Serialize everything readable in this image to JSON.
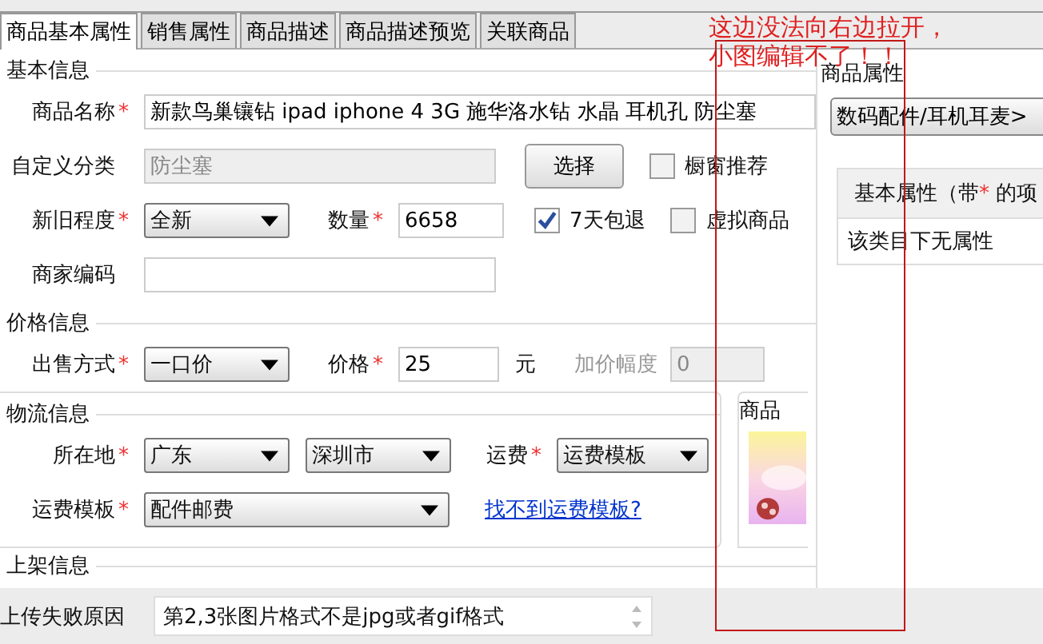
{
  "tabs": [
    {
      "label": "商品基本属性",
      "selected": true
    },
    {
      "label": "销售属性",
      "selected": false
    },
    {
      "label": "商品描述",
      "selected": false
    },
    {
      "label": "商品描述预览",
      "selected": false
    },
    {
      "label": "关联商品",
      "selected": false
    }
  ],
  "basic": {
    "legend": "基本信息",
    "name": {
      "label": "商品名称",
      "required_mark": "*",
      "value": "新款鸟巢镶钻 ipad iphone 4 3G 施华洛水钻 水晶 耳机孔 防尘塞"
    },
    "category": {
      "label": "自定义分类",
      "value": "防尘塞",
      "disabled": true,
      "button": "选择"
    },
    "showcase": {
      "label": "橱窗推荐",
      "checked": false
    },
    "condition": {
      "label": "新旧程度",
      "required_mark": "*",
      "value": "全新"
    },
    "quantity": {
      "label": "数量",
      "required_mark": "*",
      "value": "6658"
    },
    "return7": {
      "label": "7天包退",
      "checked": true
    },
    "virtual": {
      "label": "虚拟商品",
      "checked": false
    },
    "code": {
      "label": "商家编码"
    }
  },
  "price": {
    "legend": "价格信息",
    "mode": {
      "label": "出售方式",
      "required_mark": "*",
      "value": "一口价"
    },
    "price": {
      "label": "价格",
      "required_mark": "*",
      "value": "25",
      "unit": "元"
    },
    "increment": {
      "label": "加价幅度",
      "value": "0",
      "disabled": true
    }
  },
  "logistics": {
    "legend": "物流信息",
    "location": {
      "label": "所在地",
      "required_mark": "*",
      "province": "广东",
      "city": "深圳市"
    },
    "freight": {
      "label": "运费",
      "required_mark": "*",
      "value": "运费模板"
    },
    "template": {
      "label": "运费模板",
      "required_mark": "*",
      "value": "配件邮费",
      "link": "找不到运费模板?"
    }
  },
  "image_box": {
    "legend": "商品"
  },
  "listing": {
    "legend": "上架信息"
  },
  "upload_error": {
    "label": "上传失败原因",
    "value": "第2,3张图片格式不是jpg或者gif格式"
  },
  "right_panel": {
    "title": "商品属性",
    "category_button": "数码配件/耳机耳麦>",
    "table_header": "基本属性（带",
    "table_header_mark": "*",
    "table_header_rest": " 的项",
    "table_row": "该类目下无属性"
  },
  "annotation": {
    "lines": [
      "这边没法向右边拉开，",
      "小图编辑不了！！"
    ]
  }
}
